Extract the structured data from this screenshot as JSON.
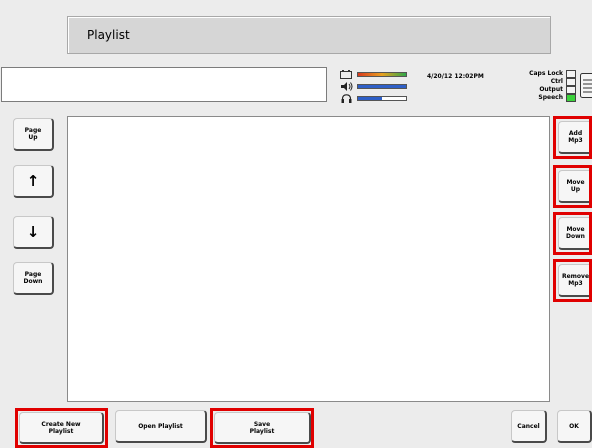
{
  "title": "Playlist",
  "status": {
    "datetime": "4/20/12 12:02PM",
    "indicators": [
      {
        "label": "Caps Lock",
        "on": false
      },
      {
        "label": "Ctrl",
        "on": false
      },
      {
        "label": "Output",
        "on": false
      },
      {
        "label": "Speech",
        "on": true
      }
    ],
    "meters": [
      {
        "icon": "battery-icon",
        "level": 1.0,
        "colors": [
          "#d83a1e",
          "#e8a020",
          "#2fa84a"
        ]
      },
      {
        "icon": "speaker-icon",
        "level": 1.0,
        "colors": [
          "#2e5fc7"
        ]
      },
      {
        "icon": "headphones-icon",
        "level": 0.5,
        "colors": [
          "#2e5fc7"
        ]
      }
    ]
  },
  "left_nav": {
    "page_up": "Page\nUp",
    "up_arrow": "↑",
    "down_arrow": "↓",
    "page_down": "Page\nDown"
  },
  "right_actions": {
    "add_mp3": "Add\nMp3",
    "move_up": "Move\nUp",
    "move_down": "Move\nDown",
    "remove_mp3": "Remove\nMp3"
  },
  "bottom": {
    "create_new_playlist": "Create New\nPlaylist",
    "open_playlist": "Open Playlist",
    "save_playlist": "Save\nPlaylist",
    "cancel": "Cancel",
    "ok": "OK"
  },
  "colors": {
    "highlight": "#e00000",
    "background": "#ececec",
    "speech_on": "#3bd23b"
  }
}
